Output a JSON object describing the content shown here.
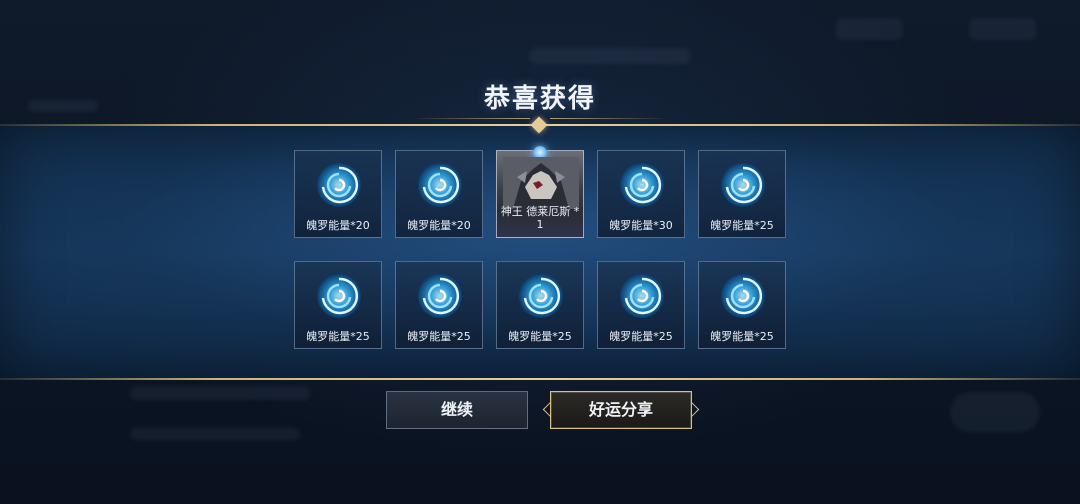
{
  "dialog": {
    "title": "恭喜获得"
  },
  "rewards": [
    {
      "label": "魄罗能量*20",
      "icon": "spiral-energy-icon"
    },
    {
      "label": "魄罗能量*20",
      "icon": "spiral-energy-icon"
    },
    {
      "label": "神王 德莱厄斯 * 1",
      "icon": "hero-portrait"
    },
    {
      "label": "魄罗能量*30",
      "icon": "spiral-energy-icon"
    },
    {
      "label": "魄罗能量*25",
      "icon": "spiral-energy-icon"
    },
    {
      "label": "魄罗能量*25",
      "icon": "spiral-energy-icon"
    },
    {
      "label": "魄罗能量*25",
      "icon": "spiral-energy-icon"
    },
    {
      "label": "魄罗能量*25",
      "icon": "spiral-energy-icon"
    },
    {
      "label": "魄罗能量*25",
      "icon": "spiral-energy-icon"
    },
    {
      "label": "魄罗能量*25",
      "icon": "spiral-energy-icon"
    }
  ],
  "buttons": {
    "continue": "继续",
    "share": "好运分享"
  },
  "colors": {
    "accent_gold": "#d8bf87",
    "energy_blue": "#4fc3ff",
    "band_blue": "#173b60"
  }
}
